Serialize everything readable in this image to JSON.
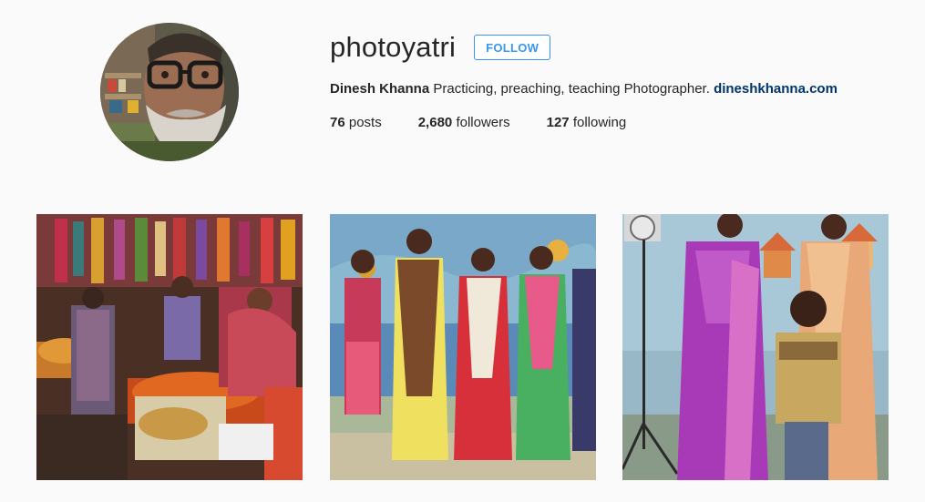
{
  "profile": {
    "username": "photoyatri",
    "follow_label": "FOLLOW",
    "full_name": "Dinesh Khanna",
    "bio": "Practicing, preaching, teaching Photographer.",
    "website": "dineshkhanna.com",
    "stats": {
      "posts_count": "76",
      "posts_label": "posts",
      "followers_count": "2,680",
      "followers_label": "followers",
      "following_count": "127",
      "following_label": "following"
    }
  },
  "colors": {
    "background": "#fafafa",
    "accent": "#3897f0",
    "link": "#003569",
    "text": "#262626"
  },
  "posts": [
    {
      "subject": "market-stall-photo"
    },
    {
      "subject": "women-in-saris-photo"
    },
    {
      "subject": "studio-portrait-photo"
    }
  ]
}
